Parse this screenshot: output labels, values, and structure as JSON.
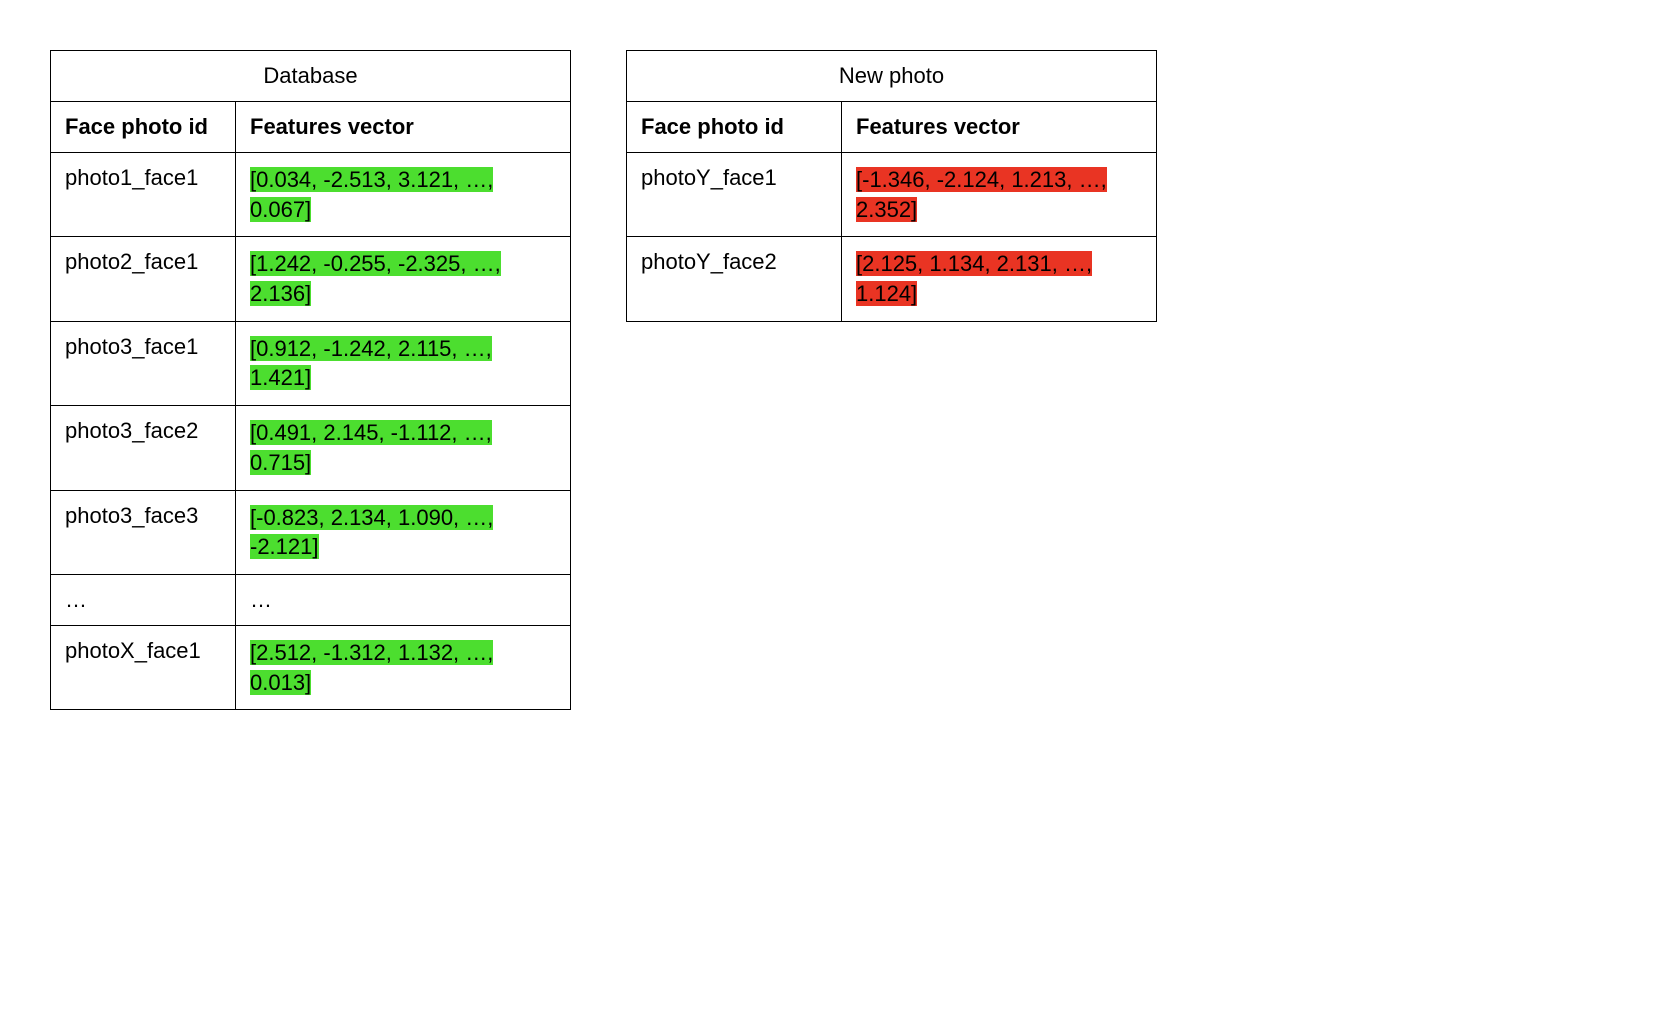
{
  "database": {
    "title": "Database",
    "headers": {
      "id": "Face photo id",
      "vector": "Features vector"
    },
    "rows": [
      {
        "id": "photo1_face1",
        "vector": "[0.034, -2.513, 3.121, …, 0.067]"
      },
      {
        "id": "photo2_face1",
        "vector": "[1.242, -0.255, -2.325, …, 2.136]"
      },
      {
        "id": "photo3_face1",
        "vector": "[0.912, -1.242, 2.115, …, 1.421]"
      },
      {
        "id": "photo3_face2",
        "vector": "[0.491, 2.145, -1.112, …, 0.715]"
      },
      {
        "id": "photo3_face3",
        "vector": "[-0.823, 2.134, 1.090, …, -2.121]"
      },
      {
        "id": "…",
        "vector": "…",
        "plain": true
      },
      {
        "id": "photoX_face1",
        "vector": "[2.512, -1.312, 1.132, …, 0.013]"
      }
    ]
  },
  "newphoto": {
    "title": "New photo",
    "headers": {
      "id": "Face photo id",
      "vector": "Features vector"
    },
    "rows": [
      {
        "id": "photoY_face1",
        "vector": "[-1.346, -2.124, 1.213, …, 2.352]"
      },
      {
        "id": "photoY_face2",
        "vector": "[2.125, 1.134, 2.131, …, 1.124]"
      }
    ]
  },
  "colors": {
    "green": "#4cde2f",
    "red": "#e93423"
  }
}
